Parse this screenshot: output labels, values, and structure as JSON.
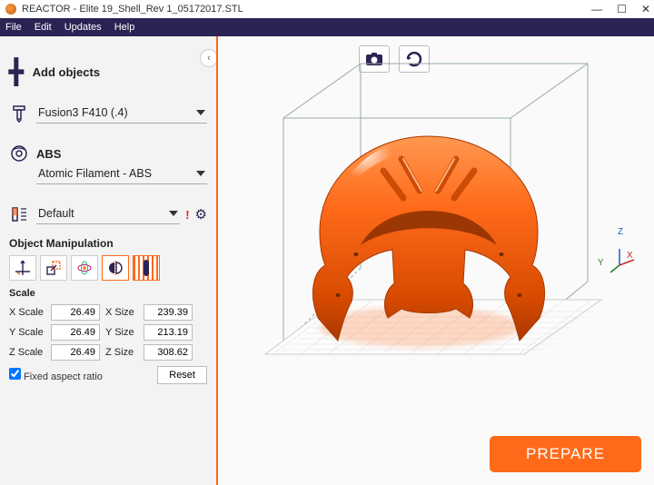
{
  "titlebar": {
    "title": "REACTOR - Elite 19_Shell_Rev 1_05172017.STL"
  },
  "menubar": {
    "file": "File",
    "edit": "Edit",
    "updates": "Updates",
    "help": "Help"
  },
  "sidebar": {
    "add_label": "Add objects",
    "printer": {
      "label": "Fusion3 F410 (.4)"
    },
    "material_short": "ABS",
    "material": {
      "label": "Atomic Filament - ABS"
    },
    "profile": {
      "label": "Default"
    },
    "manipulation_title": "Object Manipulation",
    "scale_title": "Scale",
    "x_scale_label": "X Scale",
    "y_scale_label": "Y Scale",
    "z_scale_label": "Z Scale",
    "x_size_label": "X Size",
    "y_size_label": "Y Size",
    "z_size_label": "Z Size",
    "x_scale": "26.49",
    "y_scale": "26.49",
    "z_scale": "26.49",
    "x_size": "239.39",
    "y_size": "213.19",
    "z_size": "308.62",
    "fixed_ratio": "Fixed aspect ratio",
    "reset": "Reset"
  },
  "canvas": {
    "axes": {
      "x": "X",
      "y": "Y",
      "z": "Z"
    },
    "prepare": "PREPARE"
  }
}
